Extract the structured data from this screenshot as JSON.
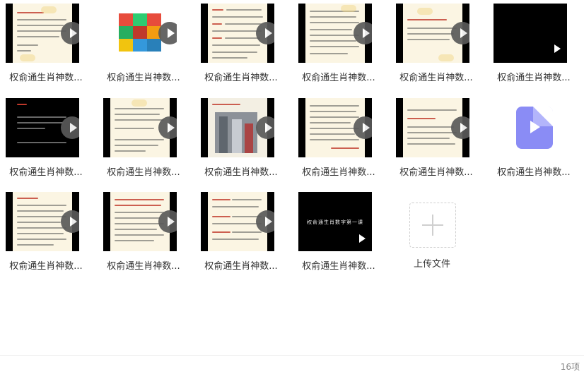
{
  "files": [
    {
      "name": "权俞通生肖神数...",
      "kind": "doc"
    },
    {
      "name": "权俞通生肖神数...",
      "kind": "grid"
    },
    {
      "name": "权俞通生肖神数...",
      "kind": "doc"
    },
    {
      "name": "权俞通生肖神数...",
      "kind": "doc"
    },
    {
      "name": "权俞通生肖神数...",
      "kind": "doc"
    },
    {
      "name": "权俞通生肖神数...",
      "kind": "black"
    },
    {
      "name": "权俞通生肖神数...",
      "kind": "doc"
    },
    {
      "name": "权俞通生肖神数...",
      "kind": "doc"
    },
    {
      "name": "权俞通生肖神数...",
      "kind": "photo"
    },
    {
      "name": "权俞通生肖神数...",
      "kind": "doc"
    },
    {
      "name": "权俞通生肖神数...",
      "kind": "doc"
    },
    {
      "name": "权俞通生肖神数...",
      "kind": "video-file"
    },
    {
      "name": "权俞通生肖神数...",
      "kind": "doc"
    },
    {
      "name": "权俞通生肖神数...",
      "kind": "doc"
    },
    {
      "name": "权俞通生肖神数...",
      "kind": "doc"
    },
    {
      "name": "权俞通生肖神数...",
      "kind": "title-card"
    }
  ],
  "title_card_text": "权俞通生肖数字第一课",
  "upload": {
    "label": "上传文件"
  },
  "footer": {
    "count": "16项"
  },
  "colors": {
    "video_icon": "#8a8cf5",
    "doc_bg": "#fbf5e3",
    "play_bg": "#5a5a5a"
  }
}
